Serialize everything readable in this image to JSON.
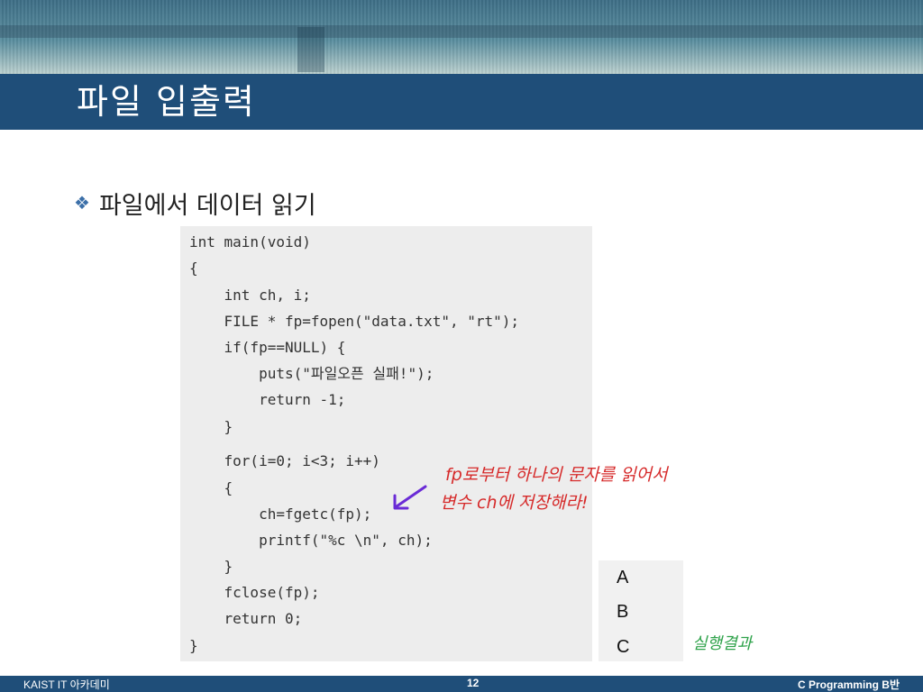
{
  "slide": {
    "title": "파일 입출력",
    "bullet_icon": "diamond-cluster-icon",
    "bullet_text": "파일에서 데이터 읽기"
  },
  "code": {
    "lines": [
      "int main(void)",
      "{",
      "    int ch, i;",
      "    FILE * fp=fopen(\"data.txt\", \"rt\");",
      "    if(fp==NULL) {",
      "        puts(\"파일오픈 실패!\");",
      "        return -1;",
      "    }",
      "    for(i=0; i<3; i++)",
      "    {",
      "        ch=fgetc(fp);",
      "        printf(\"%c \\n\", ch);",
      "    }",
      "    fclose(fp);",
      "    return 0;",
      "}"
    ]
  },
  "annotation": {
    "line1": "fp로부터 하나의 문자를 읽어서",
    "line2": "변수 ch에 저장해라!",
    "color": "#d62a2a",
    "arrow_color": "#6a2bd6"
  },
  "output": {
    "lines": [
      "A",
      "B",
      "C"
    ],
    "label": "실행결과",
    "label_color": "#2ea24a"
  },
  "footer": {
    "left": "KAIST IT 아카데미",
    "page": "12",
    "right": "C Programming B반"
  },
  "colors": {
    "title_bar": "#1f4e79",
    "bullet": "#3b6fa8"
  }
}
